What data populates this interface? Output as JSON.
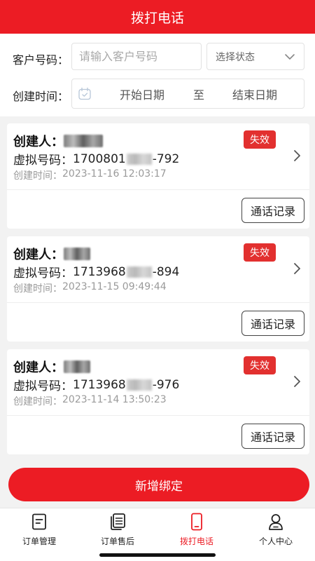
{
  "header": {
    "title": "拨打电话"
  },
  "filter": {
    "customer_label": "客户号码：",
    "customer_placeholder": "请输入客户号码",
    "status_placeholder": "选择状态",
    "time_label": "创建时间：",
    "start_date": "开始日期",
    "to": "至",
    "end_date": "结束日期"
  },
  "card_labels": {
    "creator": "创建人：",
    "virtual_number": "虚拟号码：",
    "created_time": "创建时间：",
    "call_records": "通话记录"
  },
  "records": [
    {
      "status": "失效",
      "number_prefix": "1700801",
      "number_suffix": "-792",
      "created": "2023-11-16 12:03:17"
    },
    {
      "status": "失效",
      "number_prefix": "1713968",
      "number_suffix": "-894",
      "created": "2023-11-15 09:49:44"
    },
    {
      "status": "失效",
      "number_prefix": "1713968",
      "number_suffix": "-976",
      "created": "2023-11-14 13:50:23"
    }
  ],
  "add_button": "新增绑定",
  "tabbar": {
    "items": [
      {
        "label": "订单管理",
        "icon": "document-icon"
      },
      {
        "label": "订单售后",
        "icon": "stacked-cards-icon"
      },
      {
        "label": "拨打电话",
        "icon": "phone-icon"
      },
      {
        "label": "个人中心",
        "icon": "person-icon"
      }
    ],
    "active_index": 2
  },
  "colors": {
    "brand_red": "#ec1c24",
    "badge_red": "#e2302f"
  }
}
